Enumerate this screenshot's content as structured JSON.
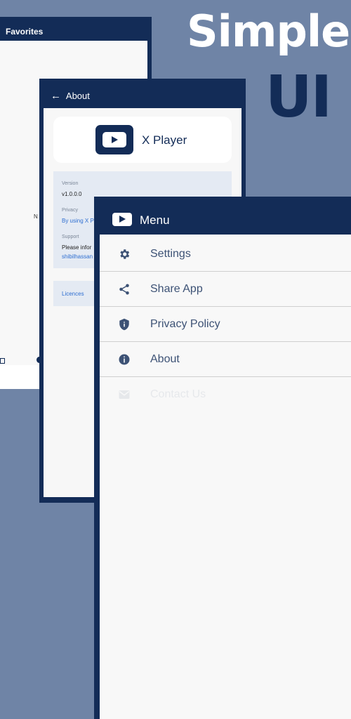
{
  "hero": {
    "line1": "Simple",
    "line2": "UI"
  },
  "favorites_screen": {
    "title": "Favorites",
    "partial_text": "N"
  },
  "about_screen": {
    "title": "About",
    "back_icon": "arrow-left-icon",
    "app_name": "X Player",
    "version_label": "Version",
    "version_value": "v1.0.0.0",
    "privacy_label": "Privacy",
    "privacy_value": "By using X P",
    "support_label": "Support",
    "support_value": "Please infor",
    "support_email": "shibilhassan",
    "licences": "Licences"
  },
  "menu_screen": {
    "title": "Menu",
    "items": [
      {
        "label": "Settings",
        "icon": "gear-icon"
      },
      {
        "label": "Share App",
        "icon": "share-icon"
      },
      {
        "label": "Privacy Policy",
        "icon": "shield-icon"
      },
      {
        "label": "About",
        "icon": "info-icon"
      },
      {
        "label": "Contact Us",
        "icon": "mail-icon"
      }
    ]
  },
  "colors": {
    "background": "#6f84a6",
    "navy": "#132c57",
    "menu_text": "#3d5275",
    "link": "#2f6fd1"
  }
}
